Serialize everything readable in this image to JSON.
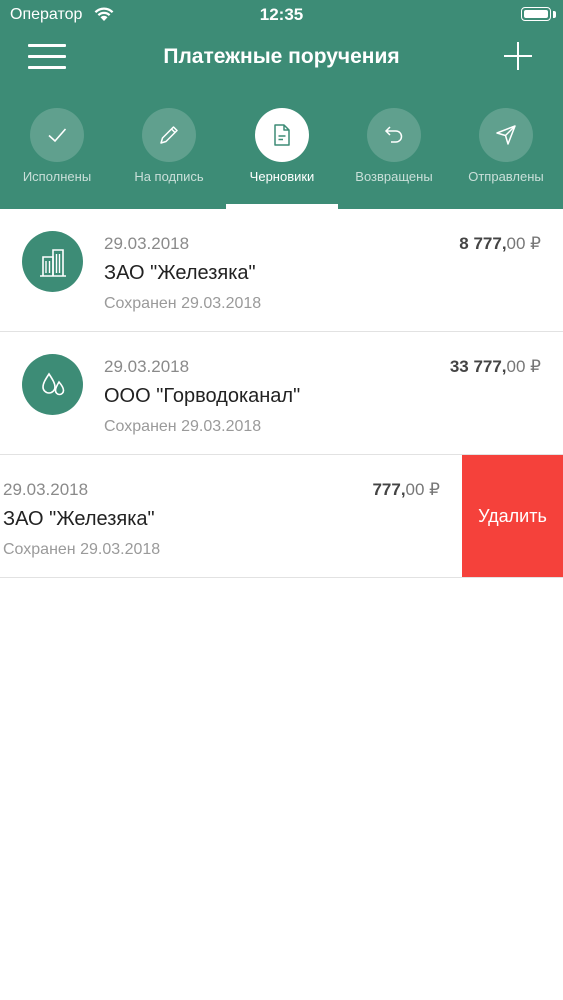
{
  "status_bar": {
    "carrier": "Оператор",
    "time": "12:35"
  },
  "header": {
    "title": "Платежные поручения"
  },
  "tabs": [
    {
      "label": "Исполнены",
      "icon": "check-icon",
      "active": false
    },
    {
      "label": "На подпись",
      "icon": "pencil-icon",
      "active": false
    },
    {
      "label": "Черновики",
      "icon": "document-icon",
      "active": true
    },
    {
      "label": "Возвращены",
      "icon": "return-arrow-icon",
      "active": false
    },
    {
      "label": "Отправлены",
      "icon": "paper-plane-icon",
      "active": false
    }
  ],
  "payments": [
    {
      "date": "29.03.2018",
      "name": "ЗАО \"Железяка\"",
      "saved": "Сохранен 29.03.2018",
      "amount_int": "8 777,",
      "amount_dec": "00 ₽",
      "icon": "buildings-icon"
    },
    {
      "date": "29.03.2018",
      "name": "ООО \"Горводоканал\"",
      "saved": "Сохранен 29.03.2018",
      "amount_int": "33 777,",
      "amount_dec": "00 ₽",
      "icon": "water-drops-icon"
    },
    {
      "date": "29.03.2018",
      "name": "ЗАО \"Железяка\"",
      "saved": "Сохранен 29.03.2018",
      "amount_int": "777,",
      "amount_dec": "00 ₽",
      "delete_label": "Удалить"
    }
  ],
  "colors": {
    "header": "#3d8c76",
    "delete": "#f5413b"
  }
}
